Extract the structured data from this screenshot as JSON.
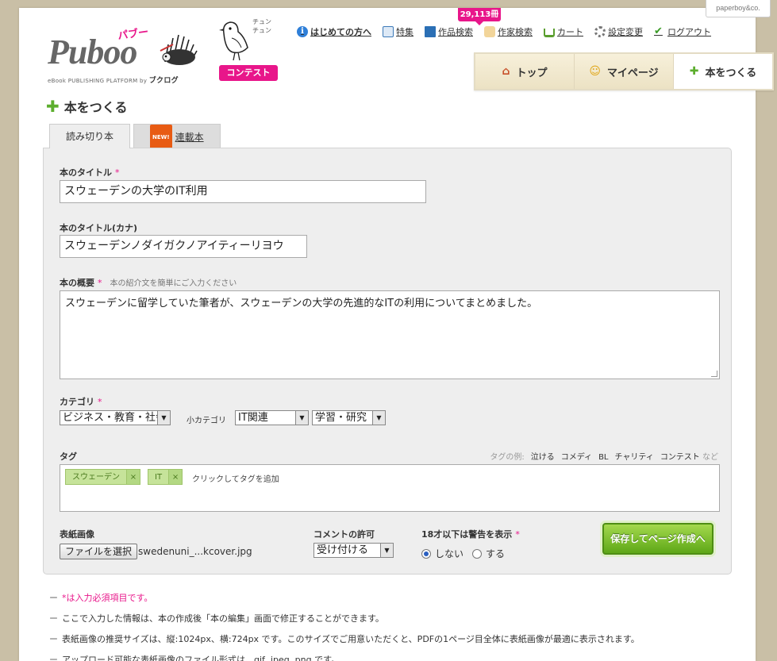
{
  "brand": {
    "logo_text": "Puboo",
    "logo_kana": "パブー",
    "logo_sub": "eBook PUBLISHING PLATFORM by",
    "logo_sub_brand": "ブクログ",
    "badge": "paperboy&co."
  },
  "contest": {
    "label": "コンテスト",
    "chirp": "チュン\nチュン"
  },
  "counter": "29,113冊",
  "topnav": [
    {
      "label": "はじめての方へ",
      "icon": "info-icon"
    },
    {
      "label": "特集",
      "icon": "book-icon"
    },
    {
      "label": "作品検索",
      "icon": "book-search-icon"
    },
    {
      "label": "作家検索",
      "icon": "author-face-icon"
    },
    {
      "label": "カート",
      "icon": "cart-icon"
    },
    {
      "label": "設定変更",
      "icon": "gear-icon"
    },
    {
      "label": "ログアウト",
      "icon": "checkmark-icon"
    }
  ],
  "maintabs": [
    {
      "label": "トップ",
      "icon": "house-icon"
    },
    {
      "label": "マイページ",
      "icon": "smiley-icon"
    },
    {
      "label": "本をつくる",
      "icon": "plus-icon"
    }
  ],
  "page_title": "本をつくる",
  "form_tabs": {
    "oneshot": "読み切り本",
    "new_badge": "NEW!",
    "serial": "連載本"
  },
  "form": {
    "title_label": "本のタイトル",
    "title_value": "スウェーデンの大学のIT利用",
    "kana_label": "本のタイトル(カナ)",
    "kana_value": "スウェーデンノダイガクノアイティーリヨウ",
    "summary_label": "本の概要",
    "summary_hint": "本の紹介文を簡単にご入力ください",
    "summary_value": "スウェーデンに留学していた筆者が、スウェーデンの大学の先進的なITの利用についてまとめました。",
    "category_label": "カテゴリ",
    "category_value": "ビジネス・教育・社会",
    "subcategory_label": "小カテゴリ",
    "subcategory_value": "IT関連",
    "subcategory2_value": "学習・研究",
    "tag_label": "タグ",
    "tag_examples_label": "タグの例:",
    "tag_examples": [
      "泣ける",
      "コメディ",
      "BL",
      "チャリティ",
      "コンテスト"
    ],
    "tag_examples_suffix": "など",
    "tags": [
      "スウェーデン",
      "IT"
    ],
    "tag_click_hint": "クリックしてタグを追加",
    "cover_label": "表紙画像",
    "file_button": "ファイルを選択",
    "file_name": "swedenuni_...kcover.jpg",
    "comment_label": "コメントの許可",
    "comment_value": "受け付ける",
    "age_label": "18才以下は警告を表示",
    "age_no": "しない",
    "age_yes": "する",
    "save_button": "保存してページ作成へ",
    "required_mark": "*"
  },
  "notes": [
    "*は入力必須項目です。",
    "ここで入力した情報は、本の作成後「本の編集」画面で修正することができます。",
    "表紙画像の推奨サイズは、縦:1024px、横:724px です。このサイズでご用意いただくと、PDFの1ページ目全体に表紙画像が最適に表示されます。",
    "アップロード可能な表紙画像のファイル形式は、gif, jpeg, png です。"
  ]
}
